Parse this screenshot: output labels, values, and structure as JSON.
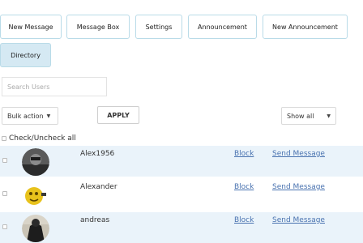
{
  "tabs": [
    {
      "label": "New Message"
    },
    {
      "label": "Message Box"
    },
    {
      "label": "Settings"
    },
    {
      "label": "Announcement"
    },
    {
      "label": "New Announcement"
    },
    {
      "label": "Directory",
      "active": true
    }
  ],
  "search": {
    "placeholder": "Search Users",
    "value": ""
  },
  "bulk_action": {
    "selected": "Bulk action"
  },
  "apply_label": "APPLY",
  "show_filter": {
    "selected": "Show all"
  },
  "check_all_label": "Check/Uncheck all",
  "users": [
    {
      "name": "Alex1956",
      "block_label": "Block",
      "send_label": "Send Message",
      "avatar": "avatar-dark-photo"
    },
    {
      "name": "Alexander",
      "block_label": "Block",
      "send_label": "Send Message",
      "avatar": "avatar-yellow-emoji"
    },
    {
      "name": "andreas",
      "block_label": "Block",
      "send_label": "Send Message",
      "avatar": "avatar-landscape-photo"
    }
  ],
  "colors": {
    "link": "#4a73b0",
    "row_stripe": "#eaf3fa",
    "tab_border": "#b9dbe8",
    "tab_active": "#d5e9f3"
  }
}
